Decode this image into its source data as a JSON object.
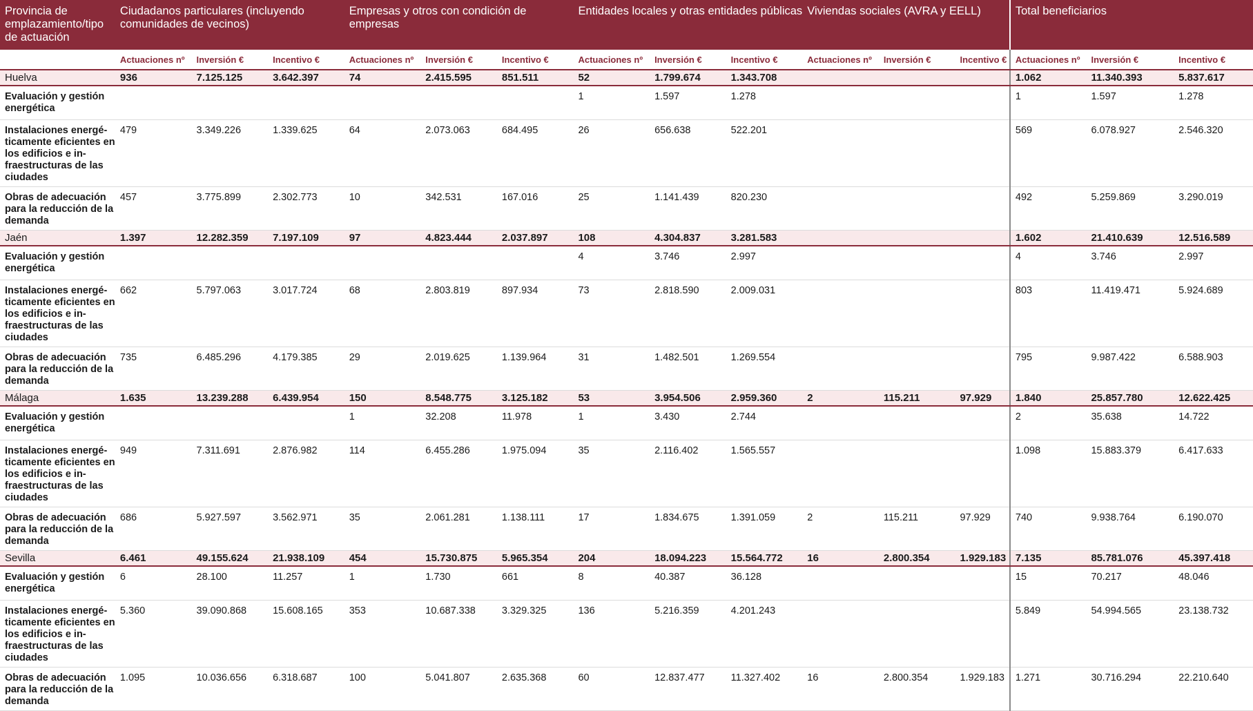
{
  "headers": {
    "provincia": "Provincia de emplazamiento/tipo de actuación",
    "groups": [
      "Ciudadanos particulares (incluyendo comunidades de vecinos)",
      "Empresas y otros con condición de empresas",
      "Entidades locales y otras entidades públicas",
      "Viviendas sociales (AVRA y EELL)",
      "Total beneficiarios"
    ],
    "sub": [
      "Actuaciones nº",
      "Inversión €",
      "Incentivo €"
    ]
  },
  "rows": [
    {
      "type": "prov",
      "label": "Huelva",
      "v": [
        "936",
        "7.125.125",
        "3.642.397",
        "74",
        "2.415.595",
        "851.511",
        "52",
        "1.799.674",
        "1.343.708",
        "",
        "",
        "",
        "1.062",
        "11.340.393",
        "5.837.617"
      ]
    },
    {
      "type": "data",
      "h": "h1",
      "label": "Evaluación y gestión energética",
      "v": [
        "",
        "",
        "",
        "",
        "",
        "",
        "1",
        "1.597",
        "1.278",
        "",
        "",
        "",
        "1",
        "1.597",
        "1.278"
      ]
    },
    {
      "type": "data",
      "h": "h4",
      "label": "Instalaciones energé-ticamente eficientes en los edificios e in-fraestructuras de las ciudades",
      "v": [
        "479",
        "3.349.226",
        "1.339.625",
        "64",
        "2.073.063",
        "684.495",
        "26",
        "656.638",
        "522.201",
        "",
        "",
        "",
        "569",
        "6.078.927",
        "2.546.320"
      ]
    },
    {
      "type": "data",
      "h": "h3",
      "label": "Obras de adecuación para la reducción de la demanda",
      "v": [
        "457",
        "3.775.899",
        "2.302.773",
        "10",
        "342.531",
        "167.016",
        "25",
        "1.141.439",
        "820.230",
        "",
        "",
        "",
        "492",
        "5.259.869",
        "3.290.019"
      ]
    },
    {
      "type": "prov",
      "label": "Jaén",
      "v": [
        "1.397",
        "12.282.359",
        "7.197.109",
        "97",
        "4.823.444",
        "2.037.897",
        "108",
        "4.304.837",
        "3.281.583",
        "",
        "",
        "",
        "1.602",
        "21.410.639",
        "12.516.589"
      ]
    },
    {
      "type": "data",
      "h": "h1",
      "label": "Evaluación y gestión energética",
      "v": [
        "",
        "",
        "",
        "",
        "",
        "",
        "4",
        "3.746",
        "2.997",
        "",
        "",
        "",
        "4",
        "3.746",
        "2.997"
      ]
    },
    {
      "type": "data",
      "h": "h4",
      "label": "Instalaciones energé-ticamente eficientes en los edificios e in-fraestructuras de las ciudades",
      "v": [
        "662",
        "5.797.063",
        "3.017.724",
        "68",
        "2.803.819",
        "897.934",
        "73",
        "2.818.590",
        "2.009.031",
        "",
        "",
        "",
        "803",
        "11.419.471",
        "5.924.689"
      ]
    },
    {
      "type": "data",
      "h": "h3",
      "label": "Obras de adecuación para la reducción de la demanda",
      "v": [
        "735",
        "6.485.296",
        "4.179.385",
        "29",
        "2.019.625",
        "1.139.964",
        "31",
        "1.482.501",
        "1.269.554",
        "",
        "",
        "",
        "795",
        "9.987.422",
        "6.588.903"
      ]
    },
    {
      "type": "prov",
      "label": "Málaga",
      "v": [
        "1.635",
        "13.239.288",
        "6.439.954",
        "150",
        "8.548.775",
        "3.125.182",
        "53",
        "3.954.506",
        "2.959.360",
        "2",
        "115.211",
        "97.929",
        "1.840",
        "25.857.780",
        "12.622.425"
      ]
    },
    {
      "type": "data",
      "h": "h1",
      "label": "Evaluación y gestión energética",
      "v": [
        "",
        "",
        "",
        "1",
        "32.208",
        "11.978",
        "1",
        "3.430",
        "2.744",
        "",
        "",
        "",
        "2",
        "35.638",
        "14.722"
      ]
    },
    {
      "type": "data",
      "h": "h4",
      "label": "Instalaciones energé-ticamente eficientes en los edificios e in-fraestructuras de las ciudades",
      "v": [
        "949",
        "7.311.691",
        "2.876.982",
        "114",
        "6.455.286",
        "1.975.094",
        "35",
        "2.116.402",
        "1.565.557",
        "",
        "",
        "",
        "1.098",
        "15.883.379",
        "6.417.633"
      ]
    },
    {
      "type": "data",
      "h": "h3",
      "label": "Obras de adecuación para la reducción de la demanda",
      "v": [
        "686",
        "5.927.597",
        "3.562.971",
        "35",
        "2.061.281",
        "1.138.111",
        "17",
        "1.834.675",
        "1.391.059",
        "2",
        "115.211",
        "97.929",
        "740",
        "9.938.764",
        "6.190.070"
      ]
    },
    {
      "type": "prov",
      "label": "Sevilla",
      "v": [
        "6.461",
        "49.155.624",
        "21.938.109",
        "454",
        "15.730.875",
        "5.965.354",
        "204",
        "18.094.223",
        "15.564.772",
        "16",
        "2.800.354",
        "1.929.183",
        "7.135",
        "85.781.076",
        "45.397.418"
      ]
    },
    {
      "type": "data",
      "h": "h1",
      "label": "Evaluación y gestión energética",
      "v": [
        "6",
        "28.100",
        "11.257",
        "1",
        "1.730",
        "661",
        "8",
        "40.387",
        "36.128",
        "",
        "",
        "",
        "15",
        "70.217",
        "48.046"
      ]
    },
    {
      "type": "data",
      "h": "h4",
      "label": "Instalaciones energé-ticamente eficientes en los edificios e in-fraestructuras de las ciudades",
      "v": [
        "5.360",
        "39.090.868",
        "15.608.165",
        "353",
        "10.687.338",
        "3.329.325",
        "136",
        "5.216.359",
        "4.201.243",
        "",
        "",
        "",
        "5.849",
        "54.994.565",
        "23.138.732"
      ]
    },
    {
      "type": "data",
      "h": "h3",
      "label": "Obras de adecuación para la reducción de la demanda",
      "v": [
        "1.095",
        "10.036.656",
        "6.318.687",
        "100",
        "5.041.807",
        "2.635.368",
        "60",
        "12.837.477",
        "11.327.402",
        "16",
        "2.800.354",
        "1.929.183",
        "1.271",
        "30.716.294",
        "22.210.640"
      ]
    }
  ]
}
